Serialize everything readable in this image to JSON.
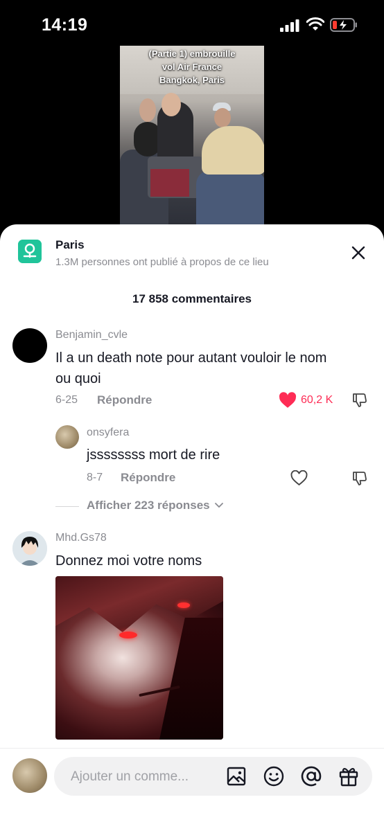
{
  "status_bar": {
    "time": "14:19"
  },
  "video": {
    "caption": "(Partie 1) embrouille\nvol Air France\nBangkok, Paris"
  },
  "location": {
    "title": "Paris",
    "subtitle": "1.3M personnes ont publié à propos de ce lieu"
  },
  "comments_count": "17 858 commentaires",
  "comments": [
    {
      "username": "Benjamin_cvle",
      "text_line1": "Il a un death note pour autant vouloir le nom",
      "text_line2": "ou quoi",
      "date": "6-25",
      "reply_label": "Répondre",
      "likes": "60,2 K"
    },
    {
      "username": "onsyfera",
      "text": "jssssssss mort de rire",
      "date": "8-7",
      "reply_label": "Répondre"
    },
    {
      "username": "Mhd.Gs78",
      "text": "Donnez moi votre noms"
    }
  ],
  "show_replies": "Afficher 223 réponses",
  "composer": {
    "placeholder": "Ajouter un comme..."
  },
  "colors": {
    "accent": "#fe2c55",
    "location_icon": "#20c49a"
  },
  "icons": [
    "signal-icon",
    "wifi-icon",
    "battery-icon",
    "close-icon",
    "heart-icon",
    "dislike-icon",
    "chevron-down-icon",
    "image-icon",
    "emoji-icon",
    "mention-icon",
    "gift-icon"
  ]
}
